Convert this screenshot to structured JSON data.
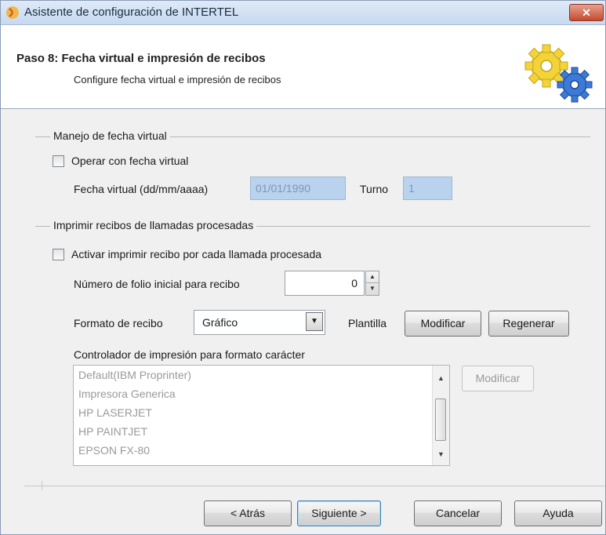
{
  "window": {
    "title": "Asistente de configuración de INTERTEL",
    "close_label": "✕"
  },
  "header": {
    "title": "Paso 8: Fecha virtual e impresión de recibos",
    "subtitle": "Configure fecha virtual e impresión de recibos"
  },
  "virtual_date": {
    "group_label": "Manejo de fecha virtual",
    "operate_label": "Operar con fecha virtual",
    "operate_checked": false,
    "date_label": "Fecha virtual (dd/mm/aaaa)",
    "date_value": "01/01/1990",
    "shift_label": "Turno",
    "shift_value": "1"
  },
  "receipts": {
    "group_label": "Imprimir recibos de llamadas procesadas",
    "activate_label": "Activar imprimir recibo por cada llamada procesada",
    "activate_checked": false,
    "folio_label": "Número de folio inicial para recibo",
    "folio_value": "0",
    "format_label": "Formato de recibo",
    "format_value": "Gráfico",
    "template_label": "Plantilla",
    "modify_label": "Modificar",
    "regenerate_label": "Regenerar",
    "driver_label": "Controlador de impresión para formato carácter",
    "drivers": [
      "Default(IBM Proprinter)",
      "Impresora Generica",
      "HP LASERJET",
      "HP PAINTJET",
      "EPSON FX-80"
    ],
    "driver_modify_label": "Modificar"
  },
  "footer": {
    "back_label": "< Atrás",
    "next_label": "Siguiente >",
    "cancel_label": "Cancelar",
    "help_label": "Ayuda"
  }
}
